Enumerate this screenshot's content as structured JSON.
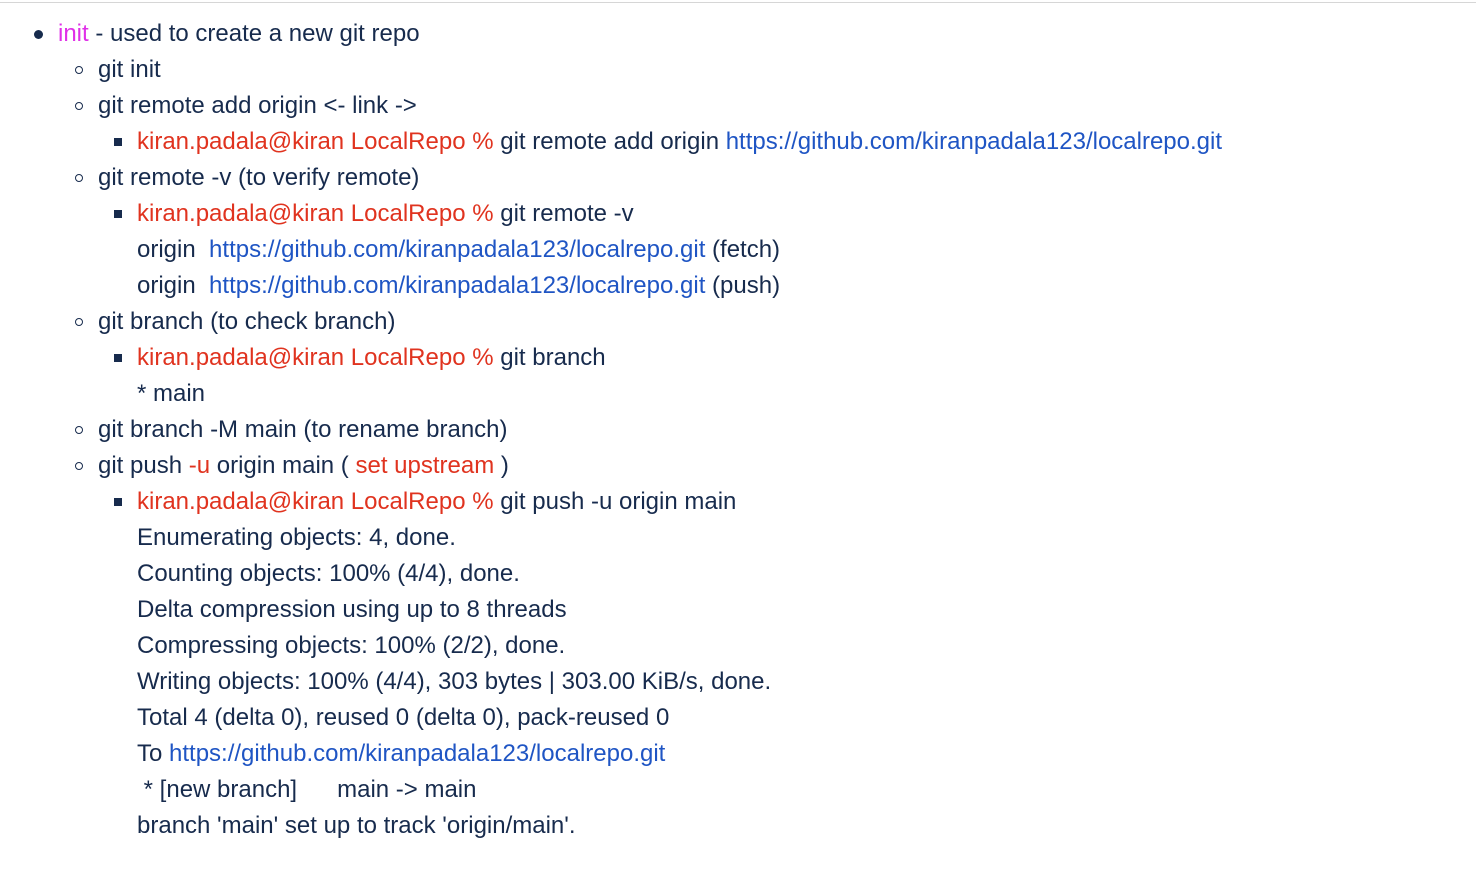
{
  "colors": {
    "text": "#172b4d",
    "keyword": "#e030e8",
    "prompt": "#e0331f",
    "link": "#1f55c4"
  },
  "init_item": {
    "keyword": "init",
    "description": " - used to create a new git repo"
  },
  "items": {
    "git_init": "git init",
    "remote_add": "git remote add origin <- link ->",
    "remote_add_example": {
      "prompt": "kiran.padala@kiran LocalRepo %",
      "command": " git remote add origin ",
      "url": "https://github.com/kiranpadala123/localrepo.git"
    },
    "remote_v": "git remote -v (to verify remote)",
    "remote_v_example": {
      "prompt": "kiran.padala@kiran LocalRepo %",
      "command": " git remote -v",
      "out1_prefix": "origin  ",
      "out1_url": "https://github.com/kiranpadala123/localrepo.git",
      "out1_suffix": " (fetch)",
      "out2_prefix": "origin  ",
      "out2_url": "https://github.com/kiranpadala123/localrepo.git",
      "out2_suffix": " (push)"
    },
    "branch": "git branch (to check branch)",
    "branch_example": {
      "prompt": "kiran.padala@kiran LocalRepo %",
      "command": " git branch",
      "output": "* main"
    },
    "rename_branch": "git branch -M main (to rename branch)",
    "push": {
      "prefix": "git push ",
      "flag": "-u",
      "middle": " origin main ( ",
      "note": "set upstream",
      "suffix": " )"
    },
    "push_example": {
      "prompt": "kiran.padala@kiran LocalRepo %",
      "command": " git push -u origin main",
      "output": [
        "Enumerating objects: 4, done.",
        "Counting objects: 100% (4/4), done.",
        "Delta compression using up to 8 threads",
        "Compressing objects: 100% (2/2), done.",
        "Writing objects: 100% (4/4), 303 bytes | 303.00 KiB/s, done.",
        "Total 4 (delta 0), reused 0 (delta 0), pack-reused 0"
      ],
      "to_prefix": "To ",
      "to_url": "https://github.com/kiranpadala123/localrepo.git",
      "new_branch": " * [new branch]      main -> main",
      "tracking": "branch 'main' set up to track 'origin/main'."
    }
  }
}
